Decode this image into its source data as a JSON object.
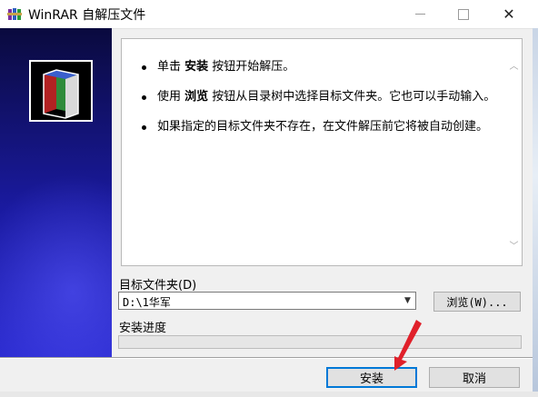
{
  "window": {
    "title": "WinRAR 自解压文件",
    "icon": "winrar-books-icon",
    "close_glyph": "✕"
  },
  "instructions": {
    "items": [
      {
        "parts": [
          {
            "text": "单击 ",
            "bold": false
          },
          {
            "text": "安装",
            "bold": true
          },
          {
            "text": " 按钮开始解压。",
            "bold": false
          }
        ]
      },
      {
        "parts": [
          {
            "text": "使用 ",
            "bold": false
          },
          {
            "text": "浏览",
            "bold": true
          },
          {
            "text": " 按钮从目录树中选择目标文件夹。它也可以手动输入。",
            "bold": false
          }
        ]
      },
      {
        "parts": [
          {
            "text": "如果指定的目标文件夹不存在，在文件解压前它将被自动创建。",
            "bold": false
          }
        ]
      }
    ]
  },
  "destination": {
    "label": "目标文件夹(D)",
    "value": "D:\\1华军"
  },
  "browse_button": {
    "label": "浏览(W)..."
  },
  "progress": {
    "label": "安装进度",
    "value": 0
  },
  "buttons": {
    "install": "安装",
    "cancel": "取消"
  },
  "colors": {
    "accent": "#0078d7",
    "annotation_arrow": "#e0202a",
    "banner_dark": "#0a0a3e",
    "banner_light": "#2b2bd0"
  }
}
